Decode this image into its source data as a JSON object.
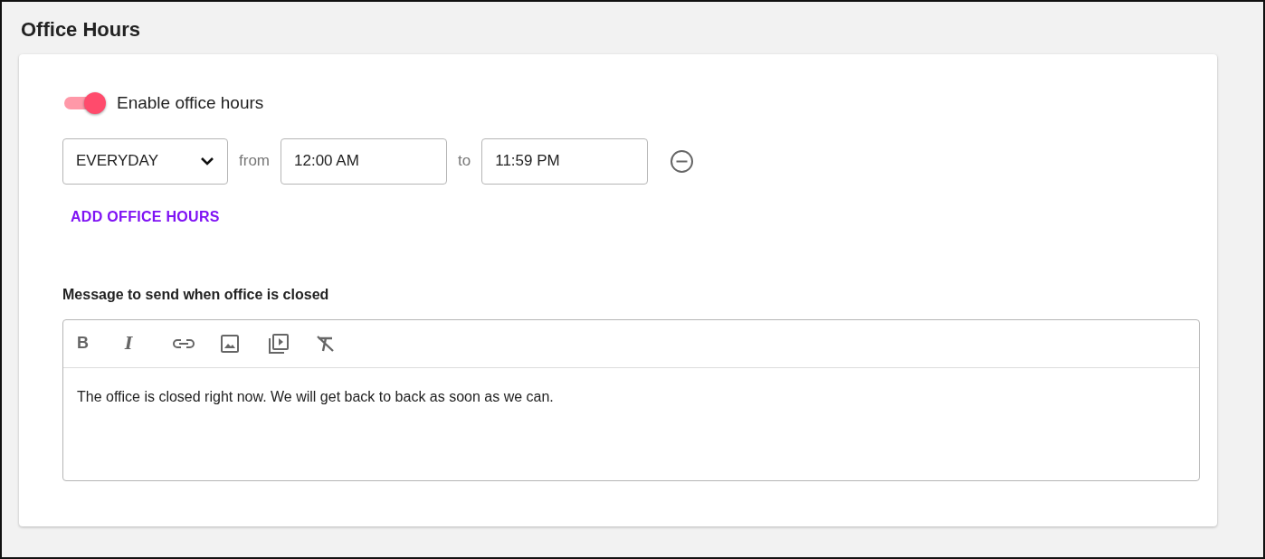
{
  "title": "Office Hours",
  "enable": {
    "label": "Enable office hours",
    "on": true
  },
  "schedule": [
    {
      "day": "EVERYDAY",
      "from_label": "from",
      "from": "12:00 AM",
      "to_label": "to",
      "to": "11:59 PM"
    }
  ],
  "add_button": "ADD OFFICE HOURS",
  "message": {
    "label": "Message to send when office is closed",
    "toolbar": [
      {
        "kind": "bold",
        "glyph": "B"
      },
      {
        "kind": "italic",
        "glyph": "I"
      },
      {
        "kind": "link"
      },
      {
        "kind": "image"
      },
      {
        "kind": "video"
      },
      {
        "kind": "clear"
      }
    ],
    "text": "The office is closed right now. We will get back to back as soon as we can."
  }
}
